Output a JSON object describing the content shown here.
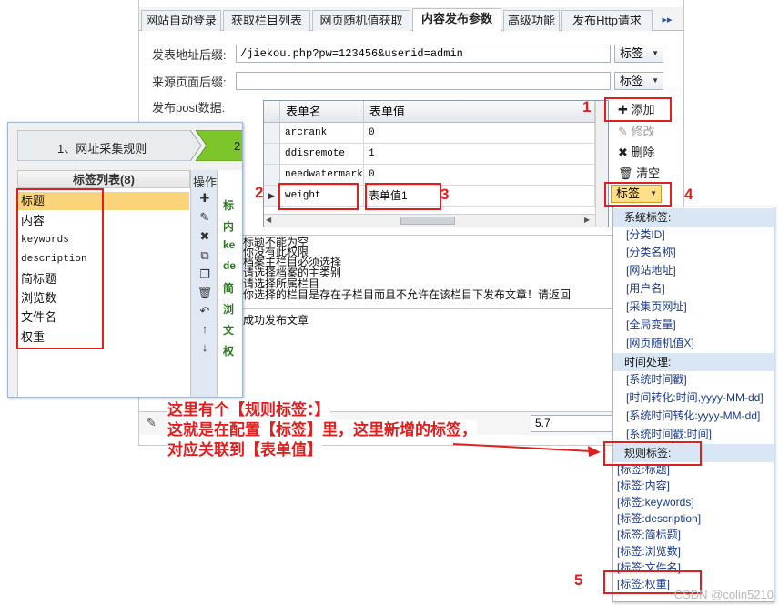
{
  "tabs": [
    {
      "label": "网站自动登录"
    },
    {
      "label": "获取栏目列表"
    },
    {
      "label": "网页随机值获取"
    },
    {
      "label": "内容发布参数"
    },
    {
      "label": "高级功能"
    },
    {
      "label": "发布Http请求"
    }
  ],
  "tab_more": "▸▸",
  "form": {
    "publish_suffix_label": "发表地址后缀:",
    "publish_suffix_value": "/jiekou.php?pw=123456&userid=admin",
    "source_suffix_label": "来源页面后缀:",
    "source_suffix_value": "",
    "post_label": "发布post数据:",
    "tag_button": "标签"
  },
  "grid": {
    "col_name": "表单名",
    "col_value": "表单值",
    "rows": [
      {
        "name": "arcrank",
        "value": "0"
      },
      {
        "name": "ddisremote",
        "value": "1"
      },
      {
        "name": "needwatermark",
        "value": "0"
      },
      {
        "name": "weight",
        "value": "表单值1"
      }
    ]
  },
  "side_buttons": {
    "add": "添加",
    "edit": "修改",
    "delete": "删除",
    "clear": "清空"
  },
  "tag_combo": "标签",
  "messages": [
    "标题不能为空",
    "你没有此权限",
    "档案主栏目必须选择",
    "请选择档案的主类别",
    "请选择所属栏目",
    "你选择的栏目是存在子栏目而且不允许在该栏目下发布文章！请返回",
    "成功发布文章"
  ],
  "bottom": {
    "version_value": "5.7"
  },
  "left_panel": {
    "step1": "1、网址采集规则",
    "step2": "2",
    "tag_list_title": "标签列表(8)",
    "ops_title": "操作",
    "tags": [
      "标题",
      "内容",
      "keywords",
      "description",
      "简标题",
      "浏览数",
      "文件名",
      "权重"
    ],
    "peek": [
      "标",
      "内",
      "ke",
      "de",
      "简",
      "浏",
      "文",
      "权"
    ]
  },
  "dropdown": {
    "groups": [
      {
        "title": "系统标签:",
        "items": [
          "[分类ID]",
          "[分类名称]",
          "[网站地址]",
          "[用户名]",
          "[采集页网址]",
          "[全局变量]",
          "[网页随机值X]"
        ]
      },
      {
        "title": "时间处理:",
        "items": [
          "[系统时间戳]",
          "[时间转化:时间,yyyy-MM-dd]",
          "[系统时间转化:yyyy-MM-dd]",
          "[系统时间戳:时间]"
        ]
      },
      {
        "title": "规则标签:",
        "items": [
          "[标签:标题]",
          "[标签:内容]",
          "[标签:keywords]",
          "[标签:description]",
          "[标签:简标题]",
          "[标签:浏览数]",
          "[标签:文件名]",
          "[标签:权重]"
        ]
      }
    ]
  },
  "annotations": {
    "num1": "1",
    "num2": "2",
    "num3": "3",
    "num4": "4",
    "num5": "5",
    "note_line1": "这里有个【规则标签：】",
    "note_line2": "这就是在配置【标签】里，这里新增的标签，",
    "note_line3": "对应关联到【表单值】",
    "watermark": "CSDN @colin5210"
  },
  "colors": {
    "annotation": "#e02020",
    "selected_tag": "#fbd37a",
    "step_active": "#7cc52b",
    "group_header": "#d9e6f4"
  }
}
